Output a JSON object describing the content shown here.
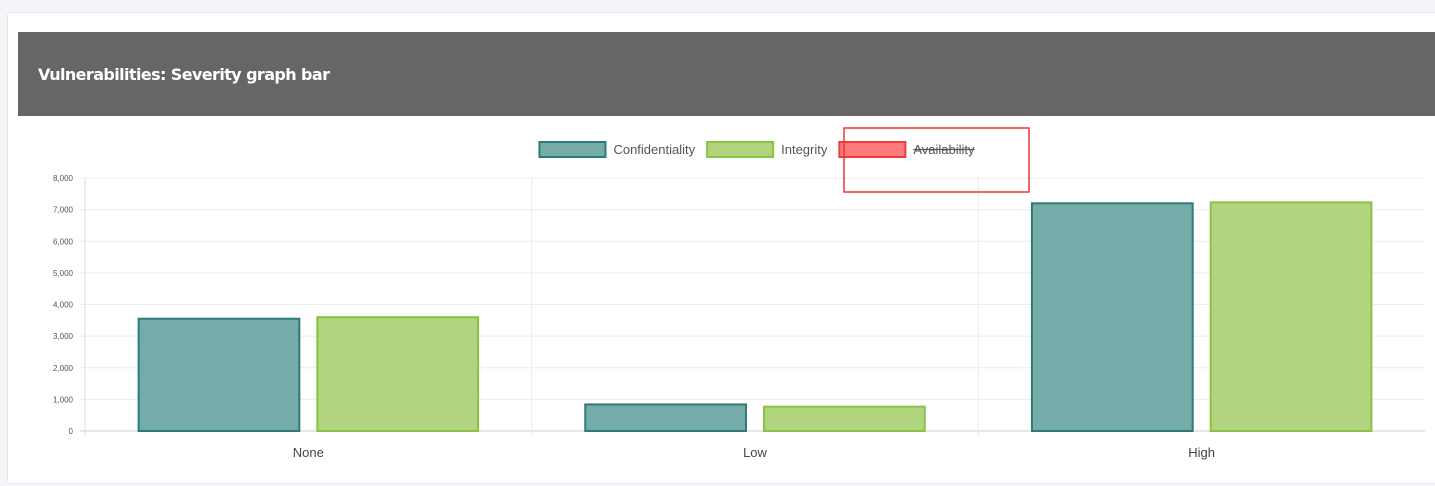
{
  "card": {
    "title": "Vulnerabilities: Severity graph bar"
  },
  "chart_data": {
    "type": "bar",
    "categories": [
      "None",
      "Low",
      "High"
    ],
    "series": [
      {
        "name": "Confidentiality",
        "values": [
          3550,
          840,
          7200
        ],
        "fill": "#73aca9",
        "stroke": "#2f7a76",
        "hidden": false
      },
      {
        "name": "Integrity",
        "values": [
          3600,
          770,
          7230
        ],
        "fill": "#b0d57e",
        "stroke": "#8ac243",
        "hidden": false
      },
      {
        "name": "Availability",
        "values": [],
        "fill": "#ff7b7b",
        "stroke": "#ee3b3b",
        "hidden": true
      }
    ],
    "ylim": [
      0,
      8000
    ],
    "y_ticks": [
      "8,000",
      "7,000",
      "6,000",
      "5,000",
      "4,000",
      "3,000",
      "2,000",
      "1,000",
      "0"
    ],
    "y_tick_values": [
      8000,
      7000,
      6000,
      5000,
      4000,
      3000,
      2000,
      1000,
      0
    ],
    "legend_position": "top-center",
    "grid": true,
    "highlight": {
      "target": "legend-item-availability",
      "color": "#e53935"
    }
  }
}
